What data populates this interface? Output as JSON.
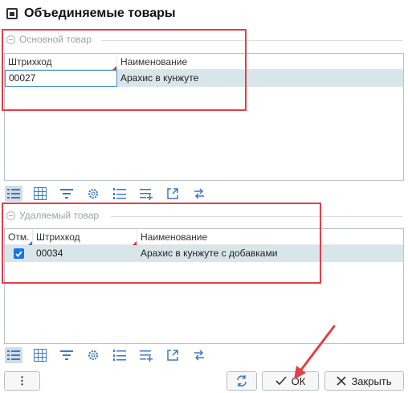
{
  "window": {
    "title": "Объединяемые товары",
    "icon": "window-icon"
  },
  "main_group": {
    "title": "Основной товар",
    "columns": [
      "Штрихкод",
      "Наименование"
    ],
    "rows": [
      {
        "barcode": "00027",
        "name": "Арахис в кунжуте"
      }
    ]
  },
  "remove_group": {
    "title": "Удаляемый товар",
    "columns": [
      "Отм.",
      "Штрихкод",
      "Наименование"
    ],
    "rows": [
      {
        "checked": true,
        "barcode": "00034",
        "name": "Арахис в кунжуте с добавками"
      }
    ]
  },
  "toolbar_icons": [
    "list-view-icon",
    "table-view-icon",
    "filter-icon",
    "settings-gear-icon",
    "numbered-list-icon",
    "add-rows-icon",
    "export-icon",
    "swap-icon"
  ],
  "footer": {
    "more_label": "⋮",
    "refresh_icon": "refresh-icon",
    "ok_label": "ОК",
    "close_label": "Закрыть"
  },
  "colors": {
    "selection_row": "#d8e6ea",
    "annotation_red": "#e0404a",
    "border": "#b9c3cb"
  }
}
